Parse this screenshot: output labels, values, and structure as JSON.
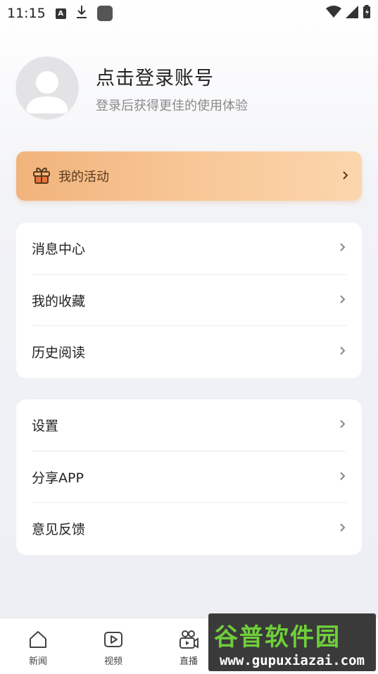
{
  "status_bar": {
    "time": "11:15",
    "notif_a": "A"
  },
  "profile": {
    "title": "点击登录账号",
    "subtitle": "登录后获得更佳的使用体验"
  },
  "activity": {
    "label": "我的活动",
    "icon": "gift-icon"
  },
  "menu_group_1": [
    {
      "label": "消息中心"
    },
    {
      "label": "我的收藏"
    },
    {
      "label": "历史阅读"
    }
  ],
  "menu_group_2": [
    {
      "label": "设置"
    },
    {
      "label": "分享APP"
    },
    {
      "label": "意见反馈"
    }
  ],
  "tabbar": [
    {
      "label": "新闻",
      "icon": "home-icon"
    },
    {
      "label": "视频",
      "icon": "video-icon"
    },
    {
      "label": "直播",
      "icon": "live-camera-icon"
    }
  ],
  "watermark": {
    "title": "谷普软件园",
    "url": "www.gupuxiazai.com"
  },
  "colors": {
    "activity_start": "#f1b37c",
    "activity_end": "#fbd6ad"
  }
}
